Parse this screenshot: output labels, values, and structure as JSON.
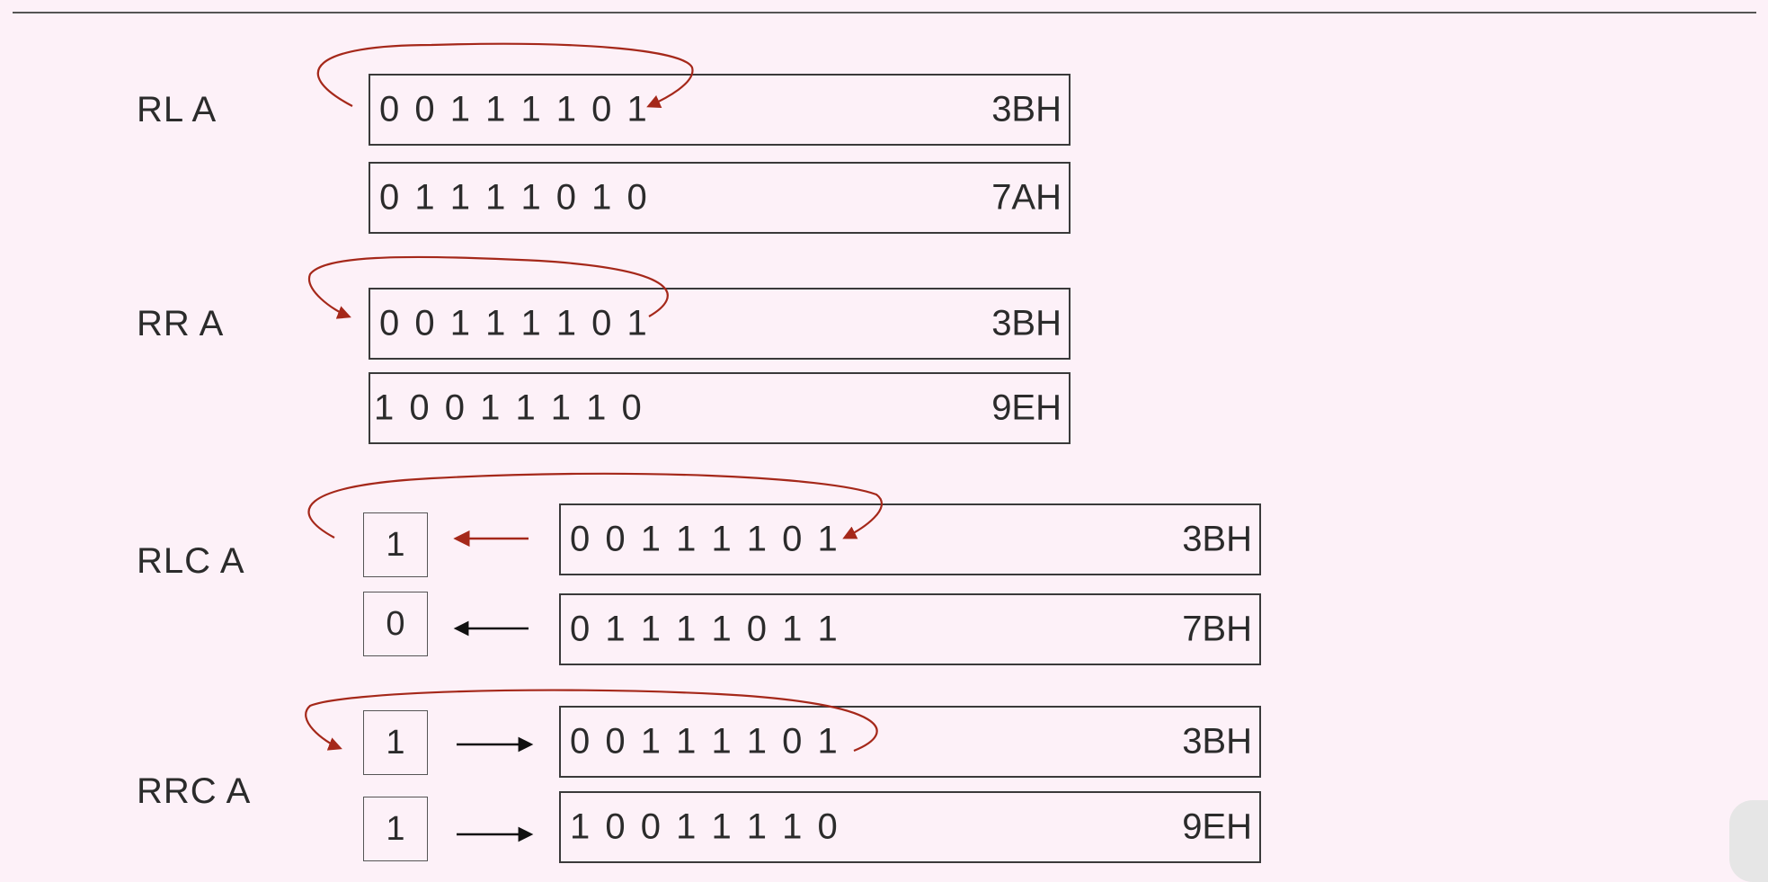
{
  "rows": [
    {
      "instruction": "RL  A",
      "before": {
        "bits": "0 0 1 1 1 1 0 1",
        "hex": "3BH"
      },
      "after": {
        "bits": "0 1 1 1 1 0 1 0",
        "hex": "7AH"
      }
    },
    {
      "instruction": "RR  A",
      "before": {
        "bits": "0 0 1 1 1 1 0 1",
        "hex": "3BH"
      },
      "after": {
        "bits": "1 0 0 1 1 1 1 0",
        "hex": "9EH"
      }
    },
    {
      "instruction": "RLC  A",
      "carry_before": "1",
      "carry_after": "0",
      "before": {
        "bits": "0 0 1 1 1 1 0 1",
        "hex": "3BH"
      },
      "after": {
        "bits": "0 1 1 1 1 0 1 1",
        "hex": "7BH"
      }
    },
    {
      "instruction": "RRC   A",
      "carry_before": "1",
      "carry_after": "1",
      "before": {
        "bits": "0 0 1 1 1 1 0 1",
        "hex": "3BH"
      },
      "after": {
        "bits": "1 0 0 1 1 1 1 0",
        "hex": "9EH"
      }
    }
  ],
  "colors": {
    "rotate_arrow": "#a5281a",
    "carry_arrow_black": "#111111",
    "background": "#fdf1f8"
  }
}
